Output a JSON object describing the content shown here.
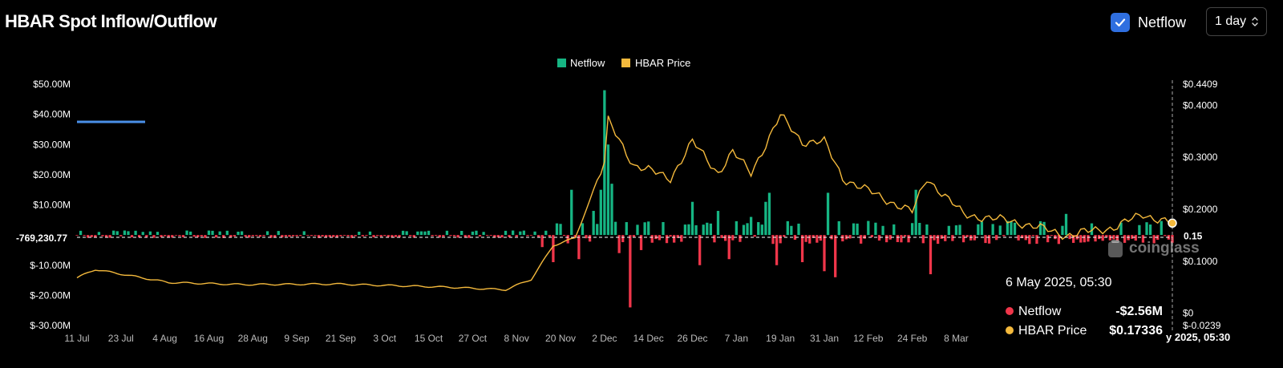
{
  "header": {
    "title": "HBAR Spot Inflow/Outflow",
    "toggle_label": "Netflow",
    "interval": "1 day"
  },
  "colors": {
    "inflow": "#16b583",
    "outflow": "#f0364a",
    "price": "#f4b93c",
    "checkbox": "#2f6fe0",
    "background": "#000000"
  },
  "chart_data": {
    "type": "bar",
    "legend": [
      {
        "name": "Netflow",
        "color": "#16b583"
      },
      {
        "name": "HBAR Price",
        "color": "#f4b93c"
      }
    ],
    "legend_placement": "top-center",
    "grid": false,
    "x_tick_labels": [
      "11 Jul",
      "23 Jul",
      "4 Aug",
      "16 Aug",
      "28 Aug",
      "9 Sep",
      "21 Sep",
      "3 Oct",
      "15 Oct",
      "27 Oct",
      "8 Nov",
      "20 Nov",
      "2 Dec",
      "14 Dec",
      "26 Dec",
      "7 Jan",
      "19 Jan",
      "31 Jan",
      "12 Feb",
      "24 Feb",
      "8 Mar"
    ],
    "y_left_ticks": [
      "$50.00M",
      "$40.00M",
      "$30.00M",
      "$20.00M",
      "$10.00M",
      "$-10.00M",
      "$-20.00M",
      "$-30.00M"
    ],
    "y_left_tick_values": [
      50,
      40,
      30,
      20,
      10,
      -10,
      -20,
      -30
    ],
    "y_left_range": [
      -30,
      50
    ],
    "y_left_crosshair_label": "-769,230.77",
    "y_left_crosshair_value": -0.769,
    "y_right_ticks": [
      "$0.4409",
      "$0.4000",
      "$0.3000",
      "$0.2000",
      "$0.1000",
      "$0",
      "$-0.0239"
    ],
    "y_right_tick_values": [
      0.4409,
      0.4,
      0.3,
      0.2,
      0.1,
      0,
      -0.0239
    ],
    "y_right_range": [
      -0.0239,
      0.4409
    ],
    "y_right_crosshair_label": "0.15",
    "y_right_crosshair_value": 0.15,
    "date_range": [
      "2024-07-11",
      "2025-05-06"
    ],
    "netflow_key_points": [
      {
        "date": "2024-11-15",
        "value": -4
      },
      {
        "date": "2024-11-18",
        "value": -9
      },
      {
        "date": "2024-11-23",
        "value": 15
      },
      {
        "date": "2024-11-25",
        "value": -8
      },
      {
        "date": "2024-11-29",
        "value": 8
      },
      {
        "date": "2024-12-01",
        "value": 15
      },
      {
        "date": "2024-12-02",
        "value": 48
      },
      {
        "date": "2024-12-03",
        "value": 30
      },
      {
        "date": "2024-12-04",
        "value": 17
      },
      {
        "date": "2024-12-06",
        "value": -6
      },
      {
        "date": "2024-12-09",
        "value": -24
      },
      {
        "date": "2024-12-12",
        "value": -5
      },
      {
        "date": "2024-12-26",
        "value": 11
      },
      {
        "date": "2024-12-28",
        "value": -10
      },
      {
        "date": "2025-01-02",
        "value": 8
      },
      {
        "date": "2025-01-05",
        "value": -8
      },
      {
        "date": "2025-01-11",
        "value": 6
      },
      {
        "date": "2025-01-15",
        "value": 11
      },
      {
        "date": "2025-01-16",
        "value": 14
      },
      {
        "date": "2025-01-18",
        "value": -10
      },
      {
        "date": "2025-01-25",
        "value": -9
      },
      {
        "date": "2025-01-31",
        "value": -12
      },
      {
        "date": "2025-02-01",
        "value": 14
      },
      {
        "date": "2025-02-03",
        "value": -14
      },
      {
        "date": "2025-02-25",
        "value": 15
      },
      {
        "date": "2025-03-01",
        "value": -13
      },
      {
        "date": "2025-04-07",
        "value": 7
      },
      {
        "date": "2025-05-06",
        "value": -2.56
      }
    ],
    "price_key_points": [
      {
        "date": "2024-07-11",
        "value": 0.068
      },
      {
        "date": "2024-07-16",
        "value": 0.084
      },
      {
        "date": "2024-08-05",
        "value": 0.059
      },
      {
        "date": "2024-08-25",
        "value": 0.055
      },
      {
        "date": "2024-09-20",
        "value": 0.056
      },
      {
        "date": "2024-10-20",
        "value": 0.05
      },
      {
        "date": "2024-11-05",
        "value": 0.045
      },
      {
        "date": "2024-11-12",
        "value": 0.065
      },
      {
        "date": "2024-11-18",
        "value": 0.13
      },
      {
        "date": "2024-11-24",
        "value": 0.145
      },
      {
        "date": "2024-12-02",
        "value": 0.29
      },
      {
        "date": "2024-12-03",
        "value": 0.37
      },
      {
        "date": "2024-12-10",
        "value": 0.285
      },
      {
        "date": "2024-12-20",
        "value": 0.26
      },
      {
        "date": "2024-12-26",
        "value": 0.33
      },
      {
        "date": "2025-01-02",
        "value": 0.27
      },
      {
        "date": "2025-01-06",
        "value": 0.31
      },
      {
        "date": "2025-01-11",
        "value": 0.27
      },
      {
        "date": "2025-01-19",
        "value": 0.38
      },
      {
        "date": "2025-01-25",
        "value": 0.33
      },
      {
        "date": "2025-01-31",
        "value": 0.33
      },
      {
        "date": "2025-02-05",
        "value": 0.26
      },
      {
        "date": "2025-02-15",
        "value": 0.225
      },
      {
        "date": "2025-02-24",
        "value": 0.195
      },
      {
        "date": "2025-02-28",
        "value": 0.26
      },
      {
        "date": "2025-03-10",
        "value": 0.19
      },
      {
        "date": "2025-03-25",
        "value": 0.175
      },
      {
        "date": "2025-04-07",
        "value": 0.15
      },
      {
        "date": "2025-04-20",
        "value": 0.165
      },
      {
        "date": "2025-04-28",
        "value": 0.19
      },
      {
        "date": "2025-05-06",
        "value": 0.17336
      }
    ]
  },
  "tooltip": {
    "title": "6 May 2025, 05:30",
    "rows": [
      {
        "label": "Netflow",
        "value": "-$2.56M"
      },
      {
        "label": "HBAR Price",
        "value": "$0.17336"
      }
    ]
  },
  "crosshair_x_label": "y 2025, 05:30",
  "watermark_text": "coinglass"
}
